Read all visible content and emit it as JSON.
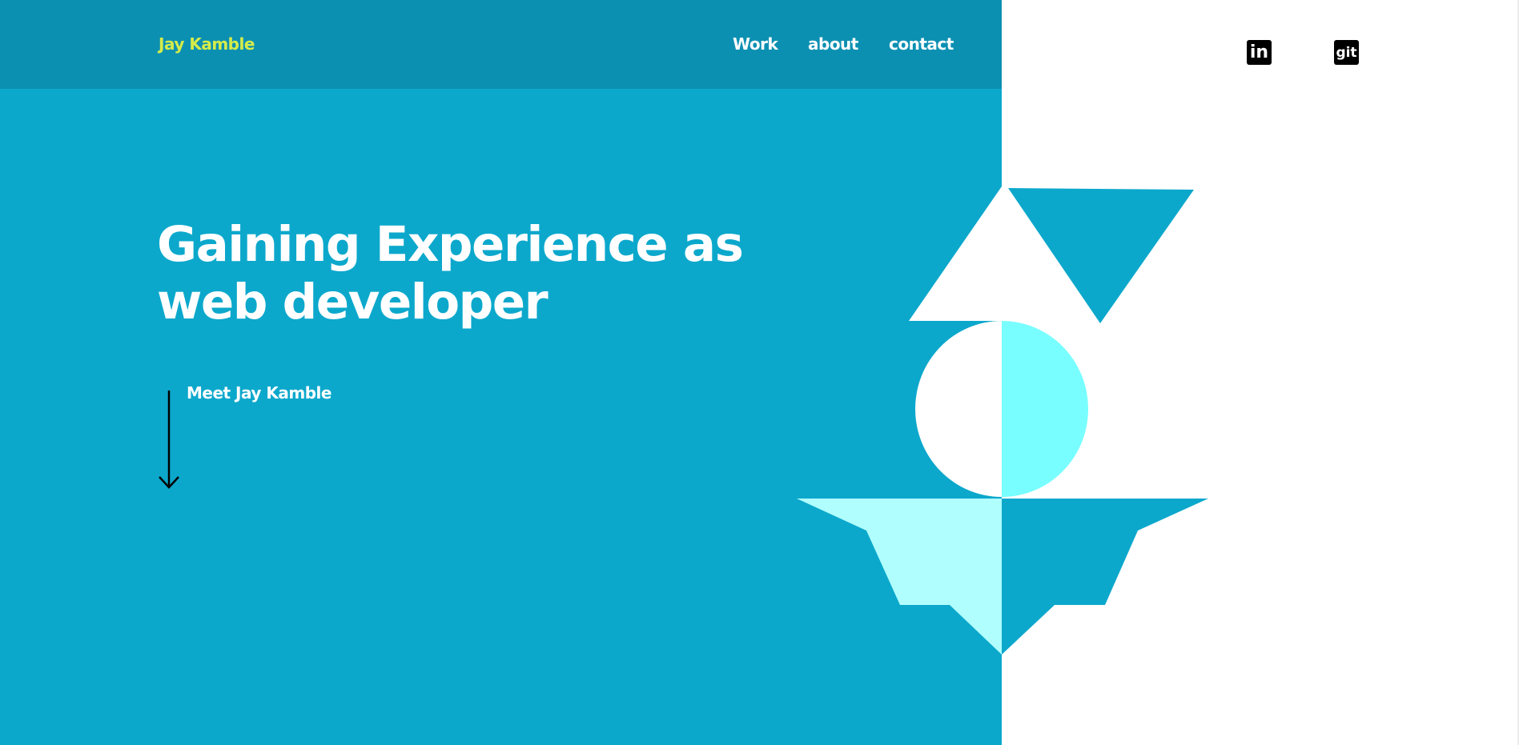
{
  "header": {
    "brand": "Jay Kamble",
    "nav": [
      {
        "label": "Work"
      },
      {
        "label": "about"
      },
      {
        "label": "contact"
      }
    ]
  },
  "social": {
    "linkedin_label": "in",
    "git_label": "git"
  },
  "hero": {
    "headline": "Gaining Experience as web developer",
    "meet_label": "Meet Jay Kamble"
  },
  "icons": {
    "arrow": "arrow-down-icon",
    "linkedin": "linkedin-icon",
    "git": "git-icon"
  },
  "colors": {
    "hero_background": "#0ca8cc",
    "header_background": "#0c90b2",
    "brand": "#d4ec4a",
    "text": "#ffffff",
    "shape_cyan": "#78feff",
    "shape_light_cyan": "#b0fefe"
  }
}
